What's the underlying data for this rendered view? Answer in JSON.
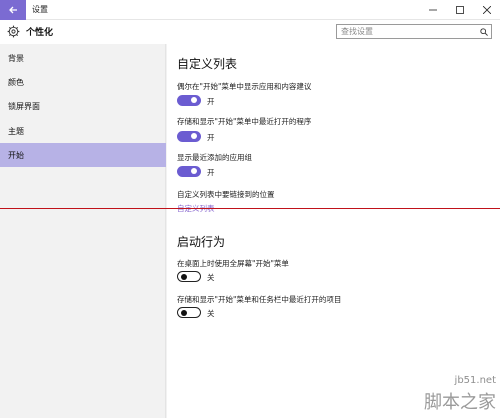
{
  "window": {
    "title": "设置",
    "controls": [
      "minimize-icon",
      "maximize-icon",
      "close-icon"
    ]
  },
  "header": {
    "title": "个性化",
    "search_placeholder": "查找设置"
  },
  "sidebar": {
    "items": [
      {
        "label": "背景",
        "active": false
      },
      {
        "label": "颜色",
        "active": false
      },
      {
        "label": "锁屏界面",
        "active": false
      },
      {
        "label": "主题",
        "active": false
      },
      {
        "label": "开始",
        "active": true
      }
    ]
  },
  "main": {
    "section1_title": "自定义列表",
    "settings1": [
      {
        "label": "偶尔在\"开始\"菜单中显示应用和内容建议",
        "state": "开",
        "on": true
      },
      {
        "label": "存储和显示\"开始\"菜单中最近打开的程序",
        "state": "开",
        "on": true
      },
      {
        "label": "显示最近添加的应用组",
        "state": "开",
        "on": true
      }
    ],
    "folders_label": "自定义列表中要链接到的位置",
    "folders_link": "自定义列表",
    "section2_title": "启动行为",
    "settings2": [
      {
        "label": "在桌面上时使用全屏幕\"开始\"菜单",
        "state": "关",
        "on": false
      },
      {
        "label": "存储和显示\"开始\"菜单和任务栏中最近打开的项目",
        "state": "关",
        "on": false
      }
    ]
  },
  "colors": {
    "accent": "#6b5cd1",
    "sidebar_active": "#b7b2e6",
    "divider_line": "#c0121a"
  },
  "watermark": {
    "line1": "jb51.net",
    "line2": "脚本之家"
  }
}
